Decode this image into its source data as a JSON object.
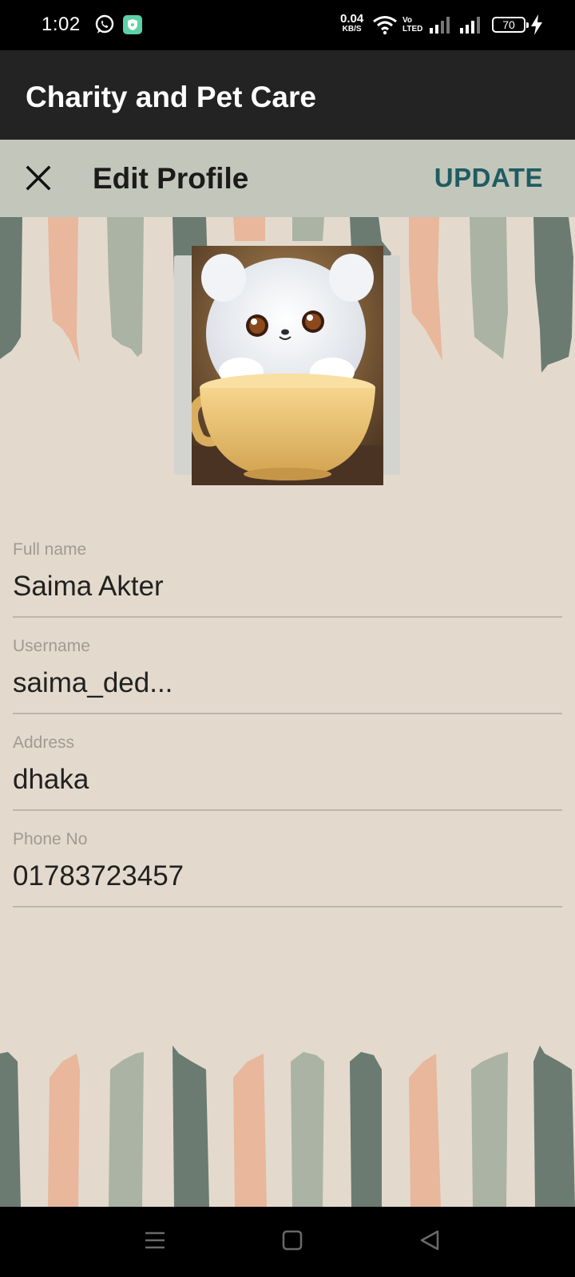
{
  "status_bar": {
    "time": "1:02",
    "net_speed": "0.04",
    "net_unit": "KB/S",
    "volte_top": "Vo",
    "volte_bottom": "LTED",
    "battery": "70",
    "icons": [
      "whatsapp-icon",
      "shield-app-icon",
      "wifi-icon",
      "volte-icon",
      "signal-icon",
      "signal-icon",
      "battery-icon",
      "charging-bolt-icon"
    ]
  },
  "app_bar": {
    "title": "Charity and Pet Care"
  },
  "toolbar": {
    "close_icon": "close-icon",
    "title": "Edit Profile",
    "update_label": "UPDATE"
  },
  "profile": {
    "photo_icon": "kitten-in-cup-photo"
  },
  "form": {
    "full_name": {
      "label": "Full name",
      "value": "Saima Akter"
    },
    "username": {
      "label": "Username",
      "value": "saima_ded..."
    },
    "address": {
      "label": "Address",
      "value": "dhaka"
    },
    "phone": {
      "label": "Phone No",
      "value": "01783723457"
    }
  },
  "nav_bar": {
    "icons": [
      "menu-icon",
      "home-icon",
      "back-icon"
    ]
  },
  "colors": {
    "background": "#e3dacd",
    "app_bar": "#232323",
    "toolbar": "#c3c6ba",
    "accent": "#1f5c62",
    "stroke_dark": "#6b7b72",
    "stroke_peach": "#e8b79c",
    "stroke_sage": "#aab3a4"
  }
}
